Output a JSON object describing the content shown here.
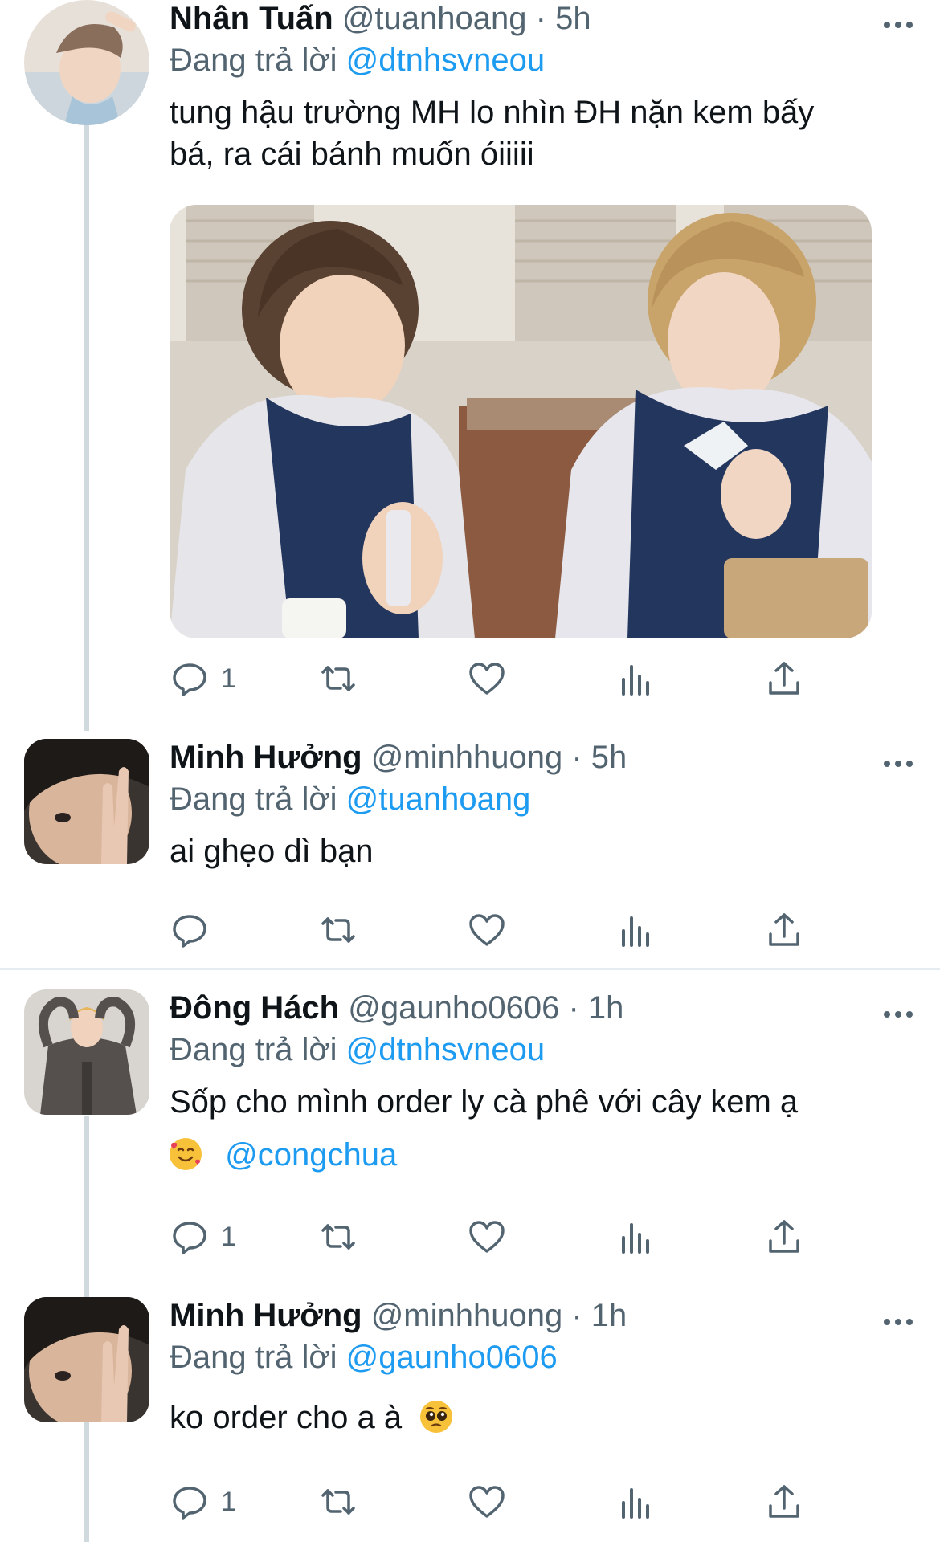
{
  "tweets": [
    {
      "name": "Nhân Tuấn",
      "handle": "@tuanhoang",
      "time": "· 5h",
      "reply_prefix": "Đang trả lời",
      "reply_to": "@dtnhsvneou",
      "text_line1": "tung hậu trường MH lo nhìn ĐH nặn kem bấy",
      "text_line2": "bá, ra cái bánh muốn óiiiii",
      "reply_count": "1"
    },
    {
      "name": "Minh Hưởng",
      "handle": "@minhhuong",
      "time": "· 5h",
      "reply_prefix": "Đang trả lời",
      "reply_to": "@tuanhoang",
      "text": "ai ghẹo dì bạn"
    },
    {
      "name": "Đông Hách",
      "handle": "@gaunho0606",
      "time": "· 1h",
      "reply_prefix": "Đang trả lời",
      "reply_to": "@dtnhsvneou",
      "text_line1": "Sốp cho mình order ly cà phê với cây kem ạ",
      "text_mention": "@congchua",
      "reply_count": "1"
    },
    {
      "name": "Minh Hưởng",
      "handle": "@minhhuong",
      "time": "· 1h",
      "reply_prefix": "Đang trả lời",
      "reply_to": "@gaunho0606",
      "text": "ko order cho a à",
      "reply_count": "1"
    }
  ],
  "colors": {
    "accent": "#1d9bf0",
    "secondary_text": "#536471",
    "thread_line": "#cfd9de",
    "divider": "#e6ecf0"
  },
  "icons": [
    "reply-icon",
    "retweet-icon",
    "like-icon",
    "analytics-icon",
    "share-icon",
    "more-icon"
  ]
}
